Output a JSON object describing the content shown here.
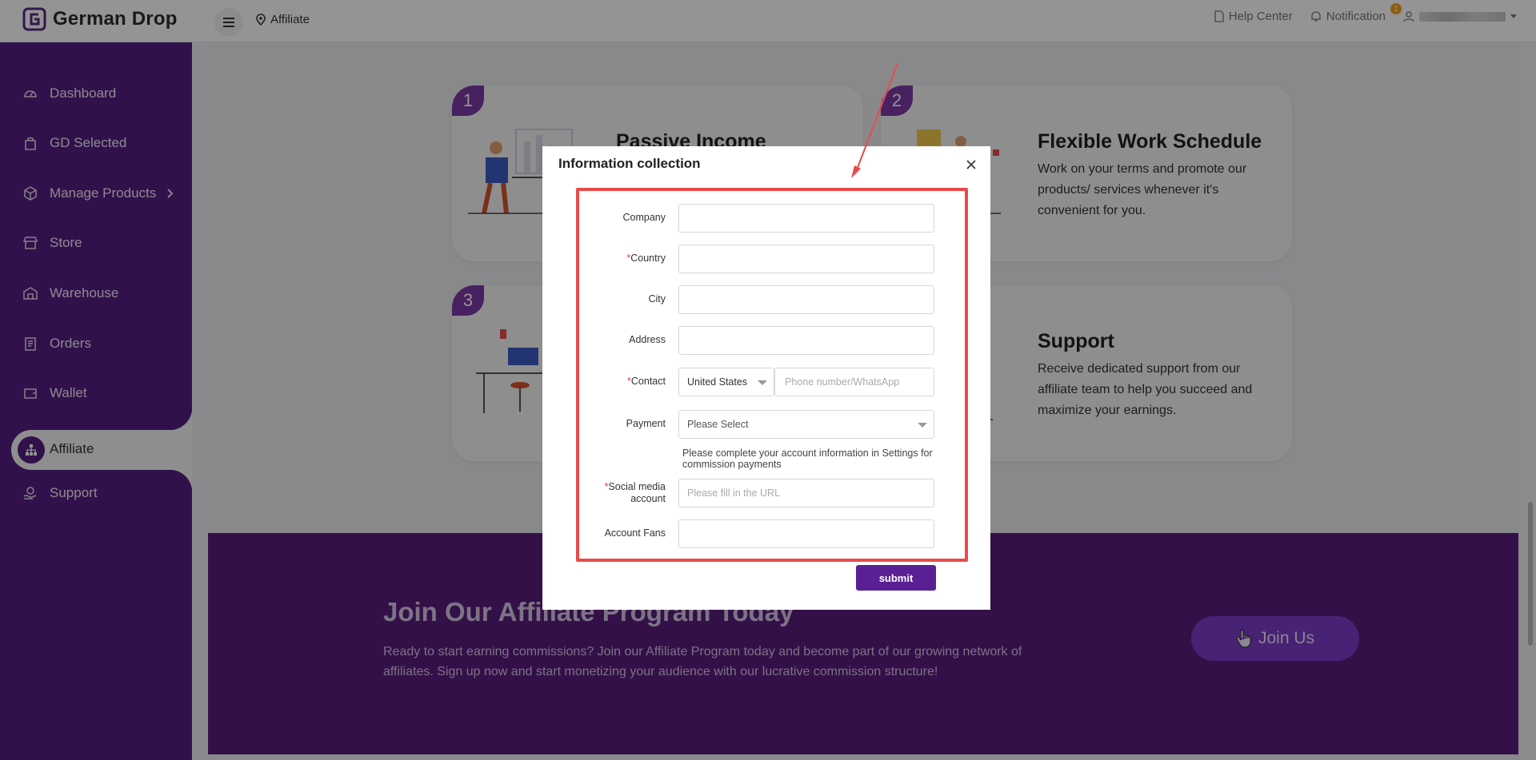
{
  "header": {
    "logo_text": "German Drop",
    "breadcrumb": "Affiliate",
    "help_center": "Help Center",
    "notification": "Notification",
    "notification_count": "1"
  },
  "sidebar": {
    "items": [
      {
        "label": "Dashboard",
        "icon": "dashboard-icon"
      },
      {
        "label": "GD Selected",
        "icon": "bag-icon"
      },
      {
        "label": "Manage Products",
        "icon": "box-icon"
      },
      {
        "label": "Store",
        "icon": "store-icon"
      },
      {
        "label": "Warehouse",
        "icon": "warehouse-icon"
      },
      {
        "label": "Orders",
        "icon": "orders-icon"
      },
      {
        "label": "Wallet",
        "icon": "wallet-icon"
      },
      {
        "label": "Affiliate",
        "icon": "affiliate-icon"
      },
      {
        "label": "Support",
        "icon": "support-icon"
      }
    ],
    "active": "Affiliate"
  },
  "cards": [
    {
      "num": "1",
      "title": "Passive Income",
      "desc": ""
    },
    {
      "num": "2",
      "title": "Flexible Work Schedule",
      "desc": "Work on your terms and promote our products/ services whenever it's convenient for you."
    },
    {
      "num": "3",
      "title": "",
      "desc": ""
    },
    {
      "num": "",
      "title": "Support",
      "desc": "Receive dedicated support from our affiliate team to help you succeed and maximize your earnings."
    }
  ],
  "banner": {
    "title": "Join Our Affiliate Program Today",
    "desc": "Ready to start earning commissions? Join our Affiliate Program today and become part of our growing network of affiliates. Sign up now and start monetizing your audience with our lucrative commission structure!",
    "button": "Join Us"
  },
  "modal": {
    "title": "Information collection",
    "fields": {
      "company": {
        "label": "Company",
        "value": ""
      },
      "country": {
        "label": "Country",
        "required": "*",
        "value": ""
      },
      "city": {
        "label": "City",
        "value": ""
      },
      "address": {
        "label": "Address",
        "value": ""
      },
      "contact": {
        "label": "Contact",
        "required": "*",
        "country_value": "United States",
        "phone_placeholder": "Phone number/WhatsApp"
      },
      "payment": {
        "label": "Payment",
        "placeholder": "Please Select",
        "hint": "Please complete your account information in Settings for commission payments"
      },
      "social": {
        "label_line1": "Social media",
        "label_line2": "account",
        "required": "*",
        "placeholder": "Please fill in the URL"
      },
      "fans": {
        "label": "Account Fans",
        "value": ""
      }
    },
    "submit": "submit"
  },
  "colors": {
    "sidebar": "#551e82",
    "accent": "#5b1f95",
    "highlight": "#e84b4b",
    "banner": "#5a1d7e"
  }
}
